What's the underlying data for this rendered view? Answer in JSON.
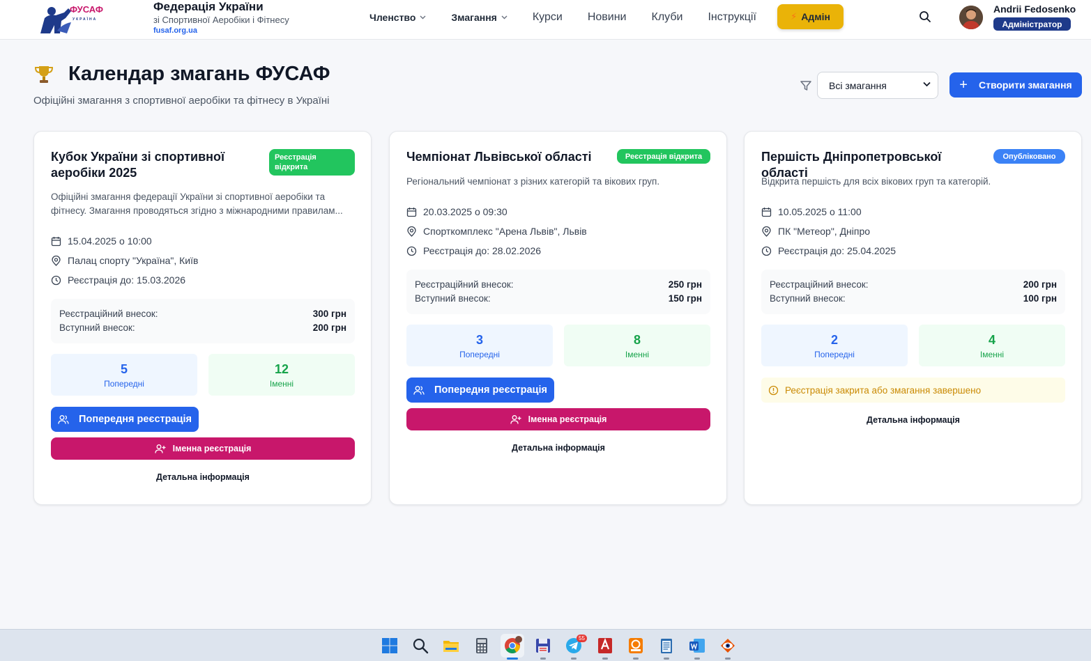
{
  "header": {
    "brand_title": "Федерація України",
    "brand_sub": "зі Спортивної Аеробіки і Фітнесу",
    "brand_link": "fusaf.org.ua",
    "logo_text": "ФУСАФ",
    "logo_subtext": "УКРАЇНА",
    "nav": [
      {
        "label": "Членство",
        "dropdown": true
      },
      {
        "label": "Змагання",
        "dropdown": true
      },
      {
        "label": "Курси"
      },
      {
        "label": "Новини"
      },
      {
        "label": "Клуби"
      },
      {
        "label": "Інструкції"
      }
    ],
    "admin_label": "Адмін",
    "user_name": "Andrii Fedosenko",
    "user_role": "Адміністратор"
  },
  "page": {
    "title": "Календар змагань ФУСАФ",
    "subtitle": "Офіційні змагання з спортивної аеробіки та фітнесу в Україні",
    "filter_value": "Всі змагання",
    "create_label": "Створити змагання"
  },
  "cards": [
    {
      "title": "Кубок України зі спортивної аеробіки 2025",
      "status": "Реєстрація відкрита",
      "description": "Офіційні змагання федерації України зі спортивної аеробіки та фітнесу. Змагання проводяться згідно з міжнародними правилам...",
      "datetime": "15.04.2025 о 10:00",
      "location": "Палац спорту \"Україна\", Київ",
      "reg_deadline": "Реєстрація до: 15.03.2026",
      "fee_reg_label": "Реєстраційний внесок:",
      "fee_reg_value": "300 грн",
      "fee_entry_label": "Вступний внесок:",
      "fee_entry_value": "200 грн",
      "prelim_count": "5",
      "prelim_label": "Попередні",
      "named_count": "12",
      "named_label": "Іменні",
      "btn_prelim": "Попередня реєстрація",
      "btn_named": "Іменна реєстрація",
      "detail": "Детальна інформація"
    },
    {
      "title": "Чемпіонат Львівської області",
      "status": "Реєстрація відкрита",
      "description": "Регіональний чемпіонат з різних категорій та вікових груп.",
      "datetime": "20.03.2025 о 09:30",
      "location": "Спорткомплекс \"Арена Львів\", Львів",
      "reg_deadline": "Реєстрація до: 28.02.2026",
      "fee_reg_label": "Реєстраційний внесок:",
      "fee_reg_value": "250 грн",
      "fee_entry_label": "Вступний внесок:",
      "fee_entry_value": "150 грн",
      "prelim_count": "3",
      "prelim_label": "Попередні",
      "named_count": "8",
      "named_label": "Іменні",
      "btn_prelim": "Попередня реєстрація",
      "btn_named": "Іменна реєстрація",
      "detail": "Детальна інформація"
    },
    {
      "title": "Першість Дніпропетровської області",
      "status": "Опубліковано",
      "description": "Відкрита першість для всіх вікових груп та категорій.",
      "datetime": "10.05.2025 о 11:00",
      "location": "ПК \"Метеор\", Дніпро",
      "reg_deadline": "Реєстрація до: 25.04.2025",
      "fee_reg_label": "Реєстраційний внесок:",
      "fee_reg_value": "200 грн",
      "fee_entry_label": "Вступний внесок:",
      "fee_entry_value": "100 грн",
      "prelim_count": "2",
      "prelim_label": "Попередні",
      "named_count": "4",
      "named_label": "Іменні",
      "warning": "Реєстрація закрита або змагання завершено",
      "detail": "Детальна інформація"
    }
  ],
  "taskbar": {
    "apps": [
      "windows-start",
      "search",
      "file-explorer",
      "calculator",
      "chrome",
      "save-app",
      "telegram",
      "autocad",
      "pdf-app",
      "notepad",
      "word",
      "eye-app"
    ],
    "telegram_badge": "55"
  },
  "colors": {
    "primary": "#2563eb",
    "magenta": "#c8176b",
    "success": "#22c55e",
    "admin": "#eab308",
    "role_badge": "#1e3a8a"
  }
}
